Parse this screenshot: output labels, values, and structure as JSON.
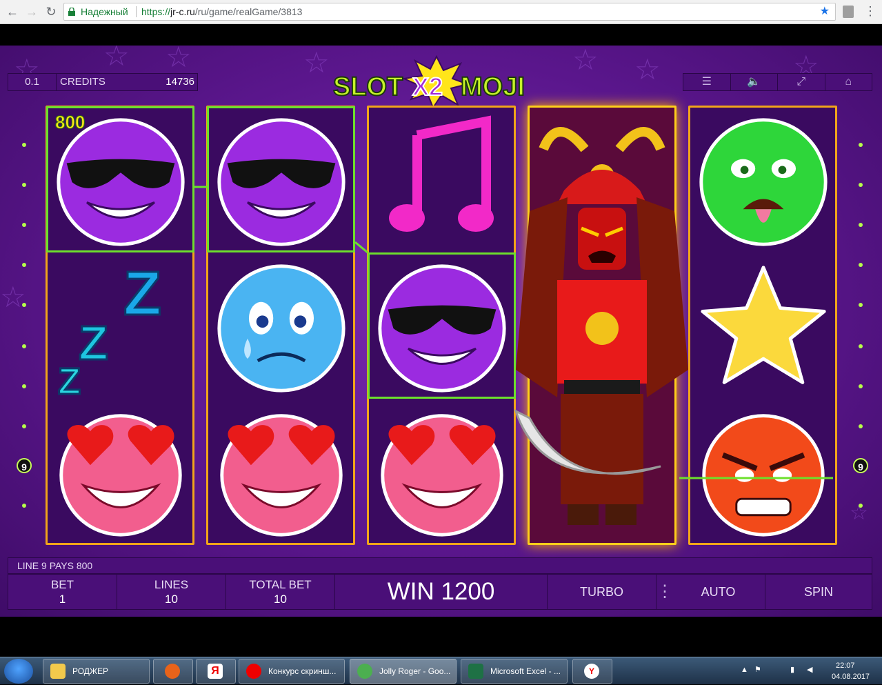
{
  "browser": {
    "secure_label": "Надежный",
    "url_scheme": "https://",
    "url_host": "jr-c.ru",
    "url_path": "/ru/game/realGame/3813"
  },
  "game": {
    "logo_text": "SLOTX2MOJI",
    "denomination": "0.1",
    "credits_label": "CREDITS",
    "credits_value": "14736",
    "win_badge": "800",
    "line_marker_left": "9",
    "line_marker_right": "9",
    "message": "LINE 9 PAYS 800",
    "bet_label": "BET",
    "bet_value": "1",
    "lines_label": "LINES",
    "lines_value": "10",
    "total_bet_label": "TOTAL BET",
    "total_bet_value": "10",
    "win_text": "WIN 1200",
    "turbo_label": "TURBO",
    "auto_label": "AUTO",
    "spin_label": "SPIN",
    "reels": [
      [
        "sunglasses-emoji",
        "sleeping-zzz",
        "heart-eyes-emoji"
      ],
      [
        "sunglasses-emoji",
        "crying-emoji",
        "heart-eyes-emoji"
      ],
      [
        "music-note",
        "sunglasses-emoji",
        "heart-eyes-emoji"
      ],
      [
        "samurai-wild",
        "samurai-wild",
        "samurai-wild"
      ],
      [
        "sick-emoji",
        "star",
        "angry-emoji"
      ]
    ]
  },
  "taskbar": {
    "items": [
      {
        "label": "РОДЖЕР"
      },
      {
        "label": "Конкурс скринш..."
      },
      {
        "label": "Jolly Roger - Goo..."
      },
      {
        "label": "Microsoft Excel - ..."
      }
    ],
    "time": "22:07",
    "date": "04.08.2017"
  },
  "colors": {
    "reel_border": "#f2a51a",
    "win_line": "#6de02c",
    "panel": "#4a0f78"
  }
}
